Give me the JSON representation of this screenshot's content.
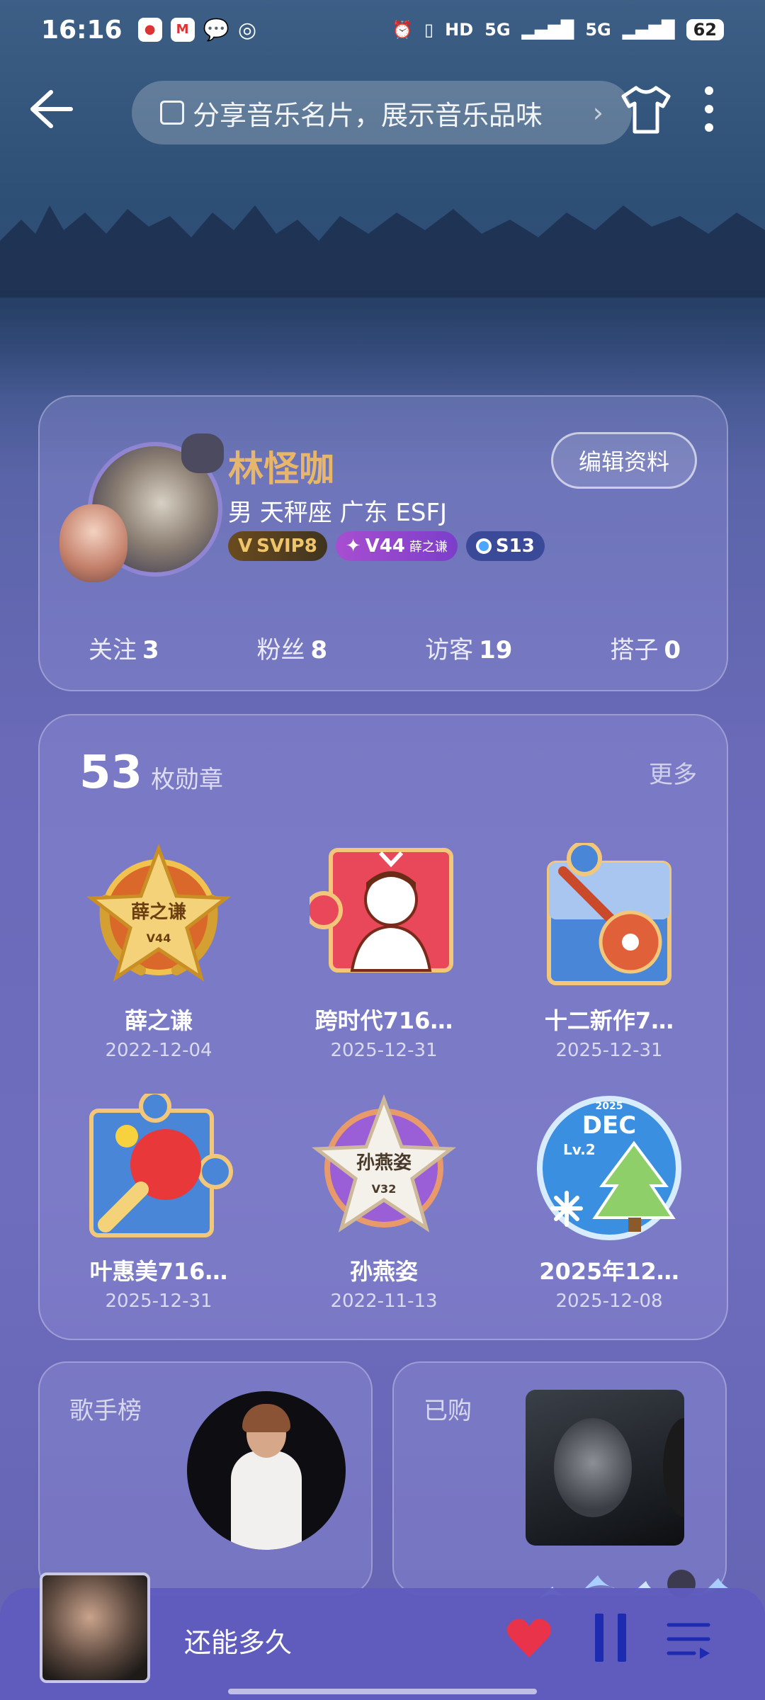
{
  "status_bar": {
    "time": "16:16",
    "signal_1": "HD",
    "network_1": "5G",
    "network_2": "5G",
    "battery": "62"
  },
  "top_bar": {
    "share_text": "分享音乐名片，展示音乐品味",
    "chevron": "›"
  },
  "profile": {
    "name": "林怪咖",
    "info": "男 天秤座 广东 ESFJ",
    "edit_label": "编辑资料",
    "badges": {
      "svip": "SVIP8",
      "vip_level": "V44",
      "vip_name": "薛之谦",
      "season": "S13"
    },
    "stats": [
      {
        "label": "关注",
        "value": "3"
      },
      {
        "label": "粉丝",
        "value": "8"
      },
      {
        "label": "访客",
        "value": "19"
      },
      {
        "label": "搭子",
        "value": "0"
      }
    ]
  },
  "medals": {
    "count": "53",
    "count_label": "枚勋章",
    "more_label": "更多",
    "items": [
      {
        "title": "薛之谦",
        "date": "2022-12-04",
        "emblem_top": "薛之谦",
        "emblem_sub": "V44"
      },
      {
        "title": "跨时代716…",
        "date": "2025-12-31"
      },
      {
        "title": "十二新作7…",
        "date": "2025-12-31"
      },
      {
        "title": "叶惠美716…",
        "date": "2025-12-31"
      },
      {
        "title": "孙燕姿",
        "date": "2022-11-13",
        "emblem_top": "孙燕姿",
        "emblem_sub": "V32"
      },
      {
        "title": "2025年12…",
        "date": "2025-12-08",
        "emblem_year": "2025",
        "emblem_month": "DEC",
        "emblem_level": "Lv.2"
      }
    ]
  },
  "tiles": {
    "singer_rank_label": "歌手榜",
    "purchased_label": "已购"
  },
  "player": {
    "song_title": "还能多久"
  },
  "colors": {
    "name_gold": "#e8b66a",
    "heart_red": "#e8334a",
    "pause_blue": "#1c2bb0"
  }
}
